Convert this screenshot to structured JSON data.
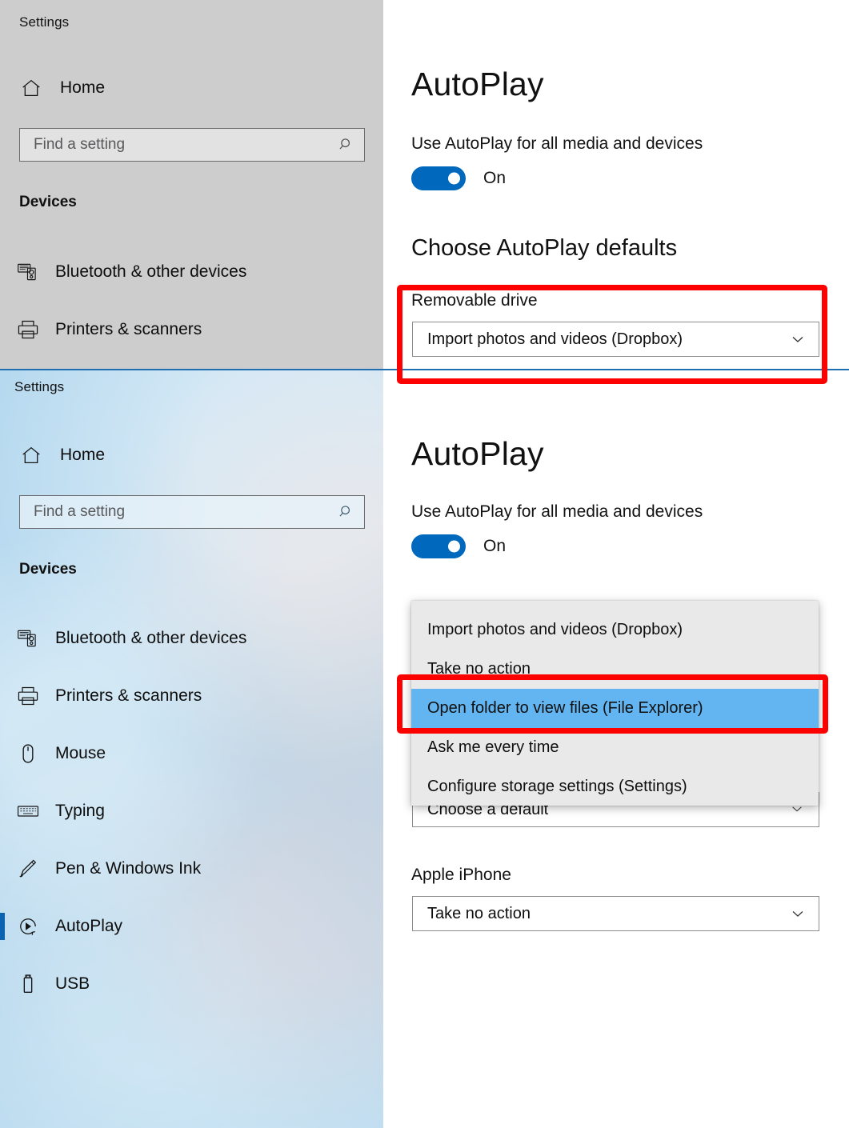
{
  "app": {
    "title": "Settings"
  },
  "sidebar": {
    "home_label": "Home",
    "home_icon": "home-icon",
    "search": {
      "placeholder": "Find a setting",
      "icon": "search-icon"
    },
    "group_header": "Devices",
    "items_top": [
      {
        "label": "Bluetooth & other devices",
        "icon": "bluetooth-devices-icon",
        "selected": false
      },
      {
        "label": "Printers & scanners",
        "icon": "printer-icon",
        "selected": false
      }
    ],
    "items_bottom": [
      {
        "label": "Bluetooth & other devices",
        "icon": "bluetooth-devices-icon",
        "selected": false
      },
      {
        "label": "Printers & scanners",
        "icon": "printer-icon",
        "selected": false
      },
      {
        "label": "Mouse",
        "icon": "mouse-icon",
        "selected": false
      },
      {
        "label": "Typing",
        "icon": "keyboard-icon",
        "selected": false
      },
      {
        "label": "Pen & Windows Ink",
        "icon": "pen-icon",
        "selected": false
      },
      {
        "label": "AutoPlay",
        "icon": "autoplay-icon",
        "selected": true
      },
      {
        "label": "USB",
        "icon": "usb-icon",
        "selected": false
      }
    ]
  },
  "page": {
    "title": "AutoPlay",
    "toggle_label": "Use AutoPlay for all media and devices",
    "toggle_state": "On",
    "toggle_on": true,
    "section_title": "Choose AutoPlay defaults",
    "removable_drive": {
      "label": "Removable drive",
      "value": "Import photos and videos (Dropbox)",
      "chevron_icon": "chevron-down-icon"
    },
    "memory_card": {
      "value": "Choose a default",
      "chevron_icon": "chevron-down-icon"
    },
    "apple_iphone": {
      "label": "Apple iPhone",
      "value": "Take no action",
      "chevron_icon": "chevron-down-icon"
    }
  },
  "dropdown": {
    "open": true,
    "options": [
      "Import photos and videos (Dropbox)",
      "Take no action",
      "Open folder to view files (File Explorer)",
      "Ask me every time",
      "Configure storage settings (Settings)"
    ],
    "selected_index": 2,
    "selected_value": "Open folder to view files (File Explorer)"
  },
  "annotations": {
    "highlight_color": "#fd0000",
    "boxes": [
      {
        "name": "removable-drive-highlight",
        "target": "Removable drive combo box"
      },
      {
        "name": "dropdown-option-highlight",
        "target": "Open folder to view files (File Explorer)"
      }
    ]
  },
  "colors": {
    "accent": "#0069bd",
    "selection": "#62b5f0",
    "sidebar_top": "#cdcdcd",
    "sidebar_bottom": "#b6d9ef",
    "divider": "#1f6eb0"
  }
}
